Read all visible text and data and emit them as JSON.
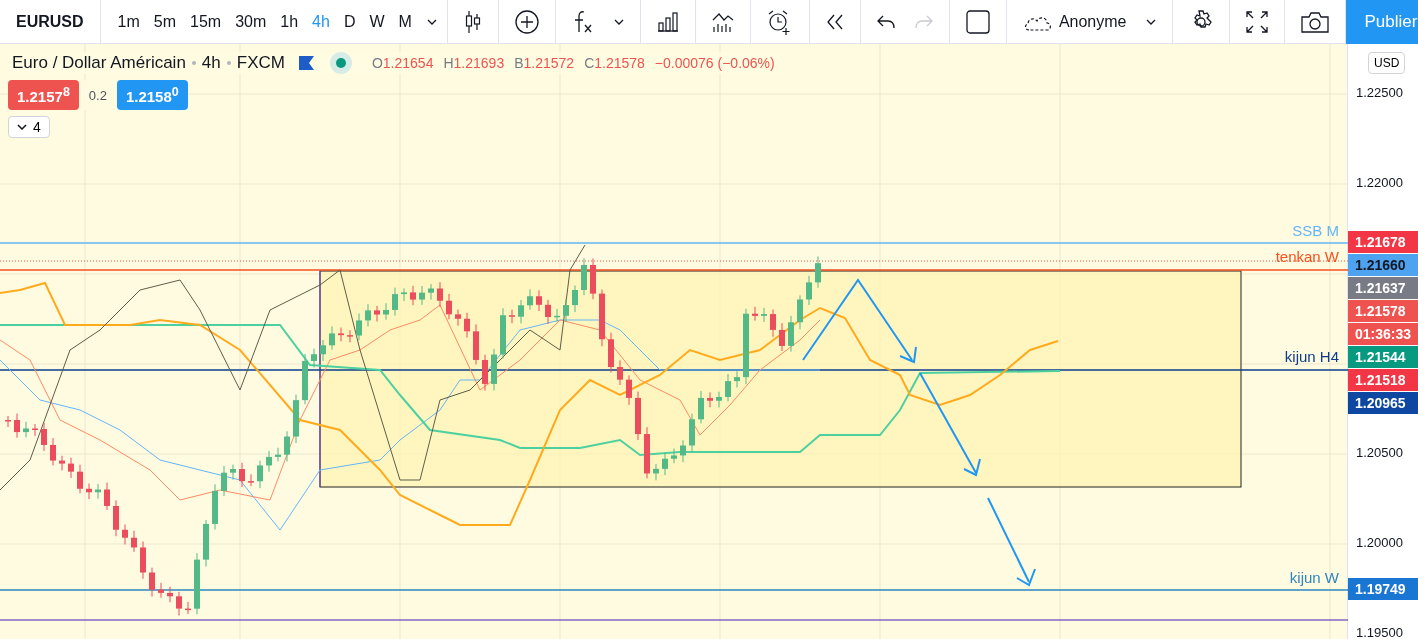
{
  "toolbar": {
    "symbol": "EURUSD",
    "intervals": [
      {
        "label": "1m",
        "selected": false
      },
      {
        "label": "5m",
        "selected": false
      },
      {
        "label": "15m",
        "selected": false
      },
      {
        "label": "30m",
        "selected": false
      },
      {
        "label": "1h",
        "selected": false
      },
      {
        "label": "4h",
        "selected": true
      },
      {
        "label": "D",
        "selected": false
      },
      {
        "label": "W",
        "selected": false
      },
      {
        "label": "M",
        "selected": false
      }
    ],
    "redo_disabled": true,
    "layout_name": "Anonyme",
    "publish": "Publier"
  },
  "legend": {
    "title": "Euro / Dollar Américain",
    "interval": "4h",
    "exchange": "FXCM",
    "ohlc": [
      {
        "key": "O",
        "value": "1.21654"
      },
      {
        "key": "H",
        "value": "1.21693"
      },
      {
        "key": "B",
        "value": "1.21572"
      },
      {
        "key": "C",
        "value": "1.21578"
      }
    ],
    "change": "−0.00076 (−0.06%)",
    "sell": "1.2157$^{8}$",
    "spread": "0.2",
    "buy": "1.2158$^{0}$",
    "indicators_count": "4"
  },
  "line_labels": [
    {
      "label": "SSB M",
      "color": "#64b5f6"
    },
    {
      "label": "tenkan W",
      "color": "#f4511e"
    },
    {
      "label": "kijun H4",
      "color": "#0d3c8c"
    },
    {
      "label": "kijun W",
      "color": "#2e86c1"
    }
  ],
  "price_axis": {
    "currency": "USD",
    "ticks": [
      "1.22500",
      "1.22000",
      "1.20500",
      "1.20000",
      "1.19500"
    ],
    "tags": [
      {
        "value": "1.21678",
        "color": "#f23645"
      },
      {
        "value": "1.21660",
        "color": "#4da3f0"
      },
      {
        "value": "1.21637",
        "color": "#787b86"
      },
      {
        "value": "1.21578",
        "color": "#ef5350"
      },
      {
        "value": "01:36:33",
        "color": "#ef5350"
      },
      {
        "value": "1.21544",
        "color": "#089981"
      },
      {
        "value": "1.21518",
        "color": "#f23645"
      },
      {
        "value": "1.20965",
        "color": "#0d47a1"
      },
      {
        "value": "1.19749",
        "color": "#1976d2"
      }
    ]
  }
}
